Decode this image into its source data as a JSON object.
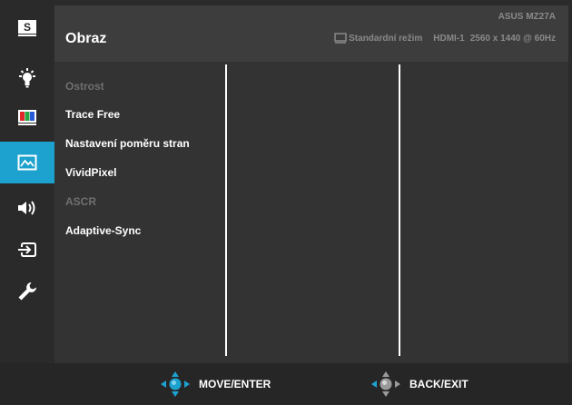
{
  "header": {
    "title": "Obraz",
    "model": "ASUS MZ27A",
    "mode": "Standardní režim",
    "input": "HDMI-1",
    "resolution": "2560 x 1440 @ 60Hz"
  },
  "sidebar": {
    "items": [
      {
        "name": "splendid",
        "icon": "s-box-icon",
        "label": "S",
        "active": false
      },
      {
        "name": "blue-light-filter",
        "icon": "light-bulb-icon",
        "active": false
      },
      {
        "name": "color",
        "icon": "color-bars-icon",
        "active": false
      },
      {
        "name": "image",
        "icon": "picture-icon",
        "active": true
      },
      {
        "name": "sound",
        "icon": "speaker-icon",
        "active": false
      },
      {
        "name": "input-select",
        "icon": "input-arrow-icon",
        "active": false
      },
      {
        "name": "system-setup",
        "icon": "wrench-icon",
        "active": false
      }
    ]
  },
  "menu": {
    "items": [
      {
        "label": "Ostrost",
        "enabled": false
      },
      {
        "label": "Trace Free",
        "enabled": true
      },
      {
        "label": "Nastavení poměru stran",
        "enabled": true
      },
      {
        "label": "VividPixel",
        "enabled": true
      },
      {
        "label": "ASCR",
        "enabled": false
      },
      {
        "label": "Adaptive-Sync",
        "enabled": true
      }
    ]
  },
  "footer": {
    "move_label": "MOVE/ENTER",
    "back_label": "BACK/EXIT"
  },
  "colors": {
    "accent": "#1da1ce",
    "panel": "#3d3d3d",
    "content": "#333333",
    "disabled_text": "#6f6f6f",
    "header_info": "#8a8a8a"
  }
}
